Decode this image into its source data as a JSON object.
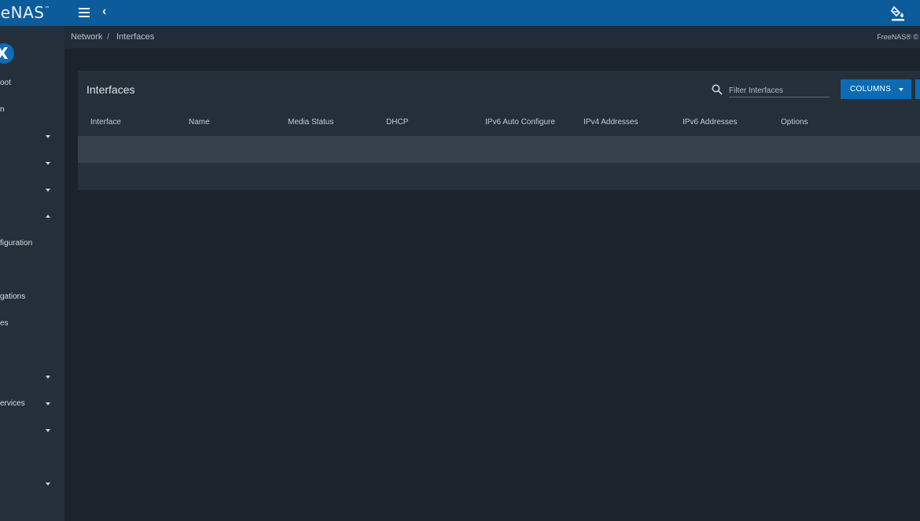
{
  "app": {
    "logo_text": "eeNAS",
    "logo_mark": "™"
  },
  "topbar": {
    "menu_icon": "menu-icon",
    "back_icon": "chevron-left-icon",
    "theme_icon": "paint-bucket-icon",
    "back_glyph": "‹"
  },
  "sidebar": {
    "items": [
      {
        "label": "oot"
      },
      {
        "label": "n"
      },
      {
        "label": "figuration"
      },
      {
        "label": "gations"
      },
      {
        "label": "es"
      },
      {
        "label": "ervices"
      }
    ]
  },
  "breadcrumb": {
    "section": "Network",
    "separator": "/",
    "current": "Interfaces",
    "copyright": "FreeNAS® ©"
  },
  "card": {
    "title": "Interfaces",
    "filter_placeholder": "Filter Interfaces",
    "columns_button": "COLUMNS",
    "columns": [
      "Interface",
      "Name",
      "Media Status",
      "DHCP",
      "IPv6 Auto Configure",
      "IPv4 Addresses",
      "IPv6 Addresses",
      "Options"
    ]
  },
  "colors": {
    "topbar": "#0c5c9c",
    "background": "#1b232c",
    "sidebar": "#242f3a",
    "accent_button": "#0c6bb3"
  }
}
